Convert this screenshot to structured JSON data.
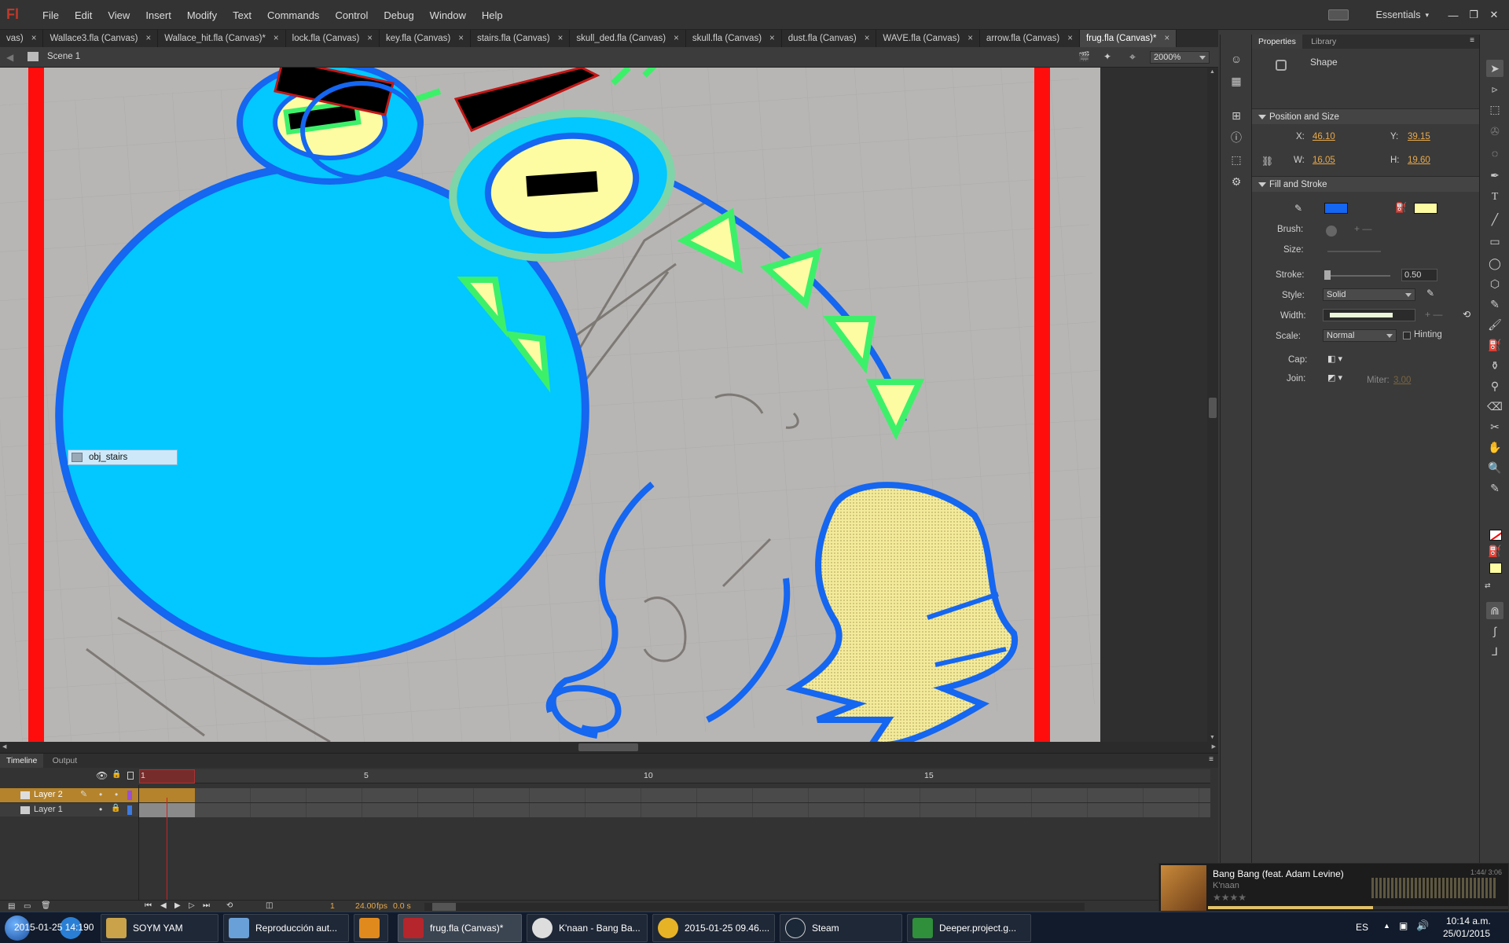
{
  "app": {
    "logo": "Fl",
    "workspace": "Essentials"
  },
  "menu": [
    "File",
    "Edit",
    "View",
    "Insert",
    "Modify",
    "Text",
    "Commands",
    "Control",
    "Debug",
    "Window",
    "Help"
  ],
  "doc_tabs": [
    {
      "label": "vas)",
      "active": false
    },
    {
      "label": "Wallace3.fla (Canvas)",
      "active": false
    },
    {
      "label": "Wallace_hit.fla (Canvas)*",
      "active": false
    },
    {
      "label": "lock.fla (Canvas)",
      "active": false
    },
    {
      "label": "key.fla (Canvas)",
      "active": false
    },
    {
      "label": "stairs.fla (Canvas)",
      "active": false
    },
    {
      "label": "skull_ded.fla (Canvas)",
      "active": false
    },
    {
      "label": "skull.fla (Canvas)",
      "active": false
    },
    {
      "label": "dust.fla (Canvas)",
      "active": false
    },
    {
      "label": "WAVE.fla (Canvas)",
      "active": false
    },
    {
      "label": "arrow.fla (Canvas)",
      "active": false
    },
    {
      "label": "frug.fla (Canvas)*",
      "active": true
    }
  ],
  "editbar": {
    "scene": "Scene 1",
    "zoom": "2000%"
  },
  "stage": {
    "tooltip_label": "obj_stairs"
  },
  "timeline": {
    "tabs": [
      "Timeline",
      "Output"
    ],
    "frame_numbers": [
      "1",
      "5",
      "10",
      "15"
    ],
    "layers": [
      {
        "name": "Layer 2",
        "selected": true,
        "color": "#9b4fd1"
      },
      {
        "name": "Layer 1",
        "selected": false,
        "color": "#3d7be0"
      }
    ],
    "current_frame": "1",
    "fps": "24.00",
    "fps_unit": "fps",
    "time": "0.0 s"
  },
  "properties": {
    "tabs": [
      "Properties",
      "Library"
    ],
    "type": "Shape",
    "position_size": {
      "title": "Position and Size",
      "x_label": "X:",
      "x": "46.10",
      "y_label": "Y:",
      "y": "39.15",
      "w_label": "W:",
      "w": "16.05",
      "h_label": "H:",
      "h": "19.60"
    },
    "fill_stroke": {
      "title": "Fill and Stroke",
      "stroke_color": "#1566f0",
      "fill_color": "#fdfca2",
      "brush_label": "Brush:",
      "size_label": "Size:",
      "stroke_label": "Stroke:",
      "stroke_value": "0.50",
      "style_label": "Style:",
      "style_value": "Solid",
      "width_label": "Width:",
      "scale_label": "Scale:",
      "scale_value": "Normal",
      "hinting_label": "Hinting",
      "cap_label": "Cap:",
      "join_label": "Join:",
      "miter_label": "Miter:",
      "miter_value": "3.00"
    }
  },
  "tools": [
    "selection-tool",
    "subselection-tool",
    "free-transform-tool",
    "3d-rotation-tool",
    "lasso-tool",
    "pen-tool",
    "text-tool",
    "line-tool",
    "rectangle-tool",
    "oval-tool",
    "polystar-tool",
    "pencil-tool",
    "brush-tool",
    "paint-bucket-tool",
    "ink-bottle-tool",
    "eyedropper-tool",
    "eraser-tool",
    "bone-tool",
    "hand-tool",
    "zoom-tool"
  ],
  "tool_colors": {
    "stroke": "#ff0000",
    "fill": "#fdfca2"
  },
  "taskbar": {
    "buttons": [
      {
        "label": "SOYM YAM",
        "color": "#c9a24a"
      },
      {
        "label": "Reproducción aut...",
        "color": "#6aa0d8"
      },
      {
        "label": "",
        "color": "#e08a1e"
      },
      {
        "label": "frug.fla (Canvas)*",
        "color": "#b4262b"
      },
      {
        "label": "K'naan - Bang Ba...",
        "color": "#ddd"
      },
      {
        "label": "2015-01-25 09.46....",
        "color": "#e7b326"
      },
      {
        "label": "Steam",
        "color": "#1b2838"
      },
      {
        "label": "Deeper.project.g...",
        "color": "#2f8f3a"
      }
    ],
    "overlay_text": "2015-01-25 14:190",
    "lang": "ES",
    "time": "10:14 a.m.",
    "date": "25/01/2015"
  },
  "music": {
    "title": "Bang Bang (feat. Adam Levine)",
    "artist": "K'naan",
    "time": "1:44/ 3:06",
    "rating_stars": 4,
    "progress": 0.55
  }
}
